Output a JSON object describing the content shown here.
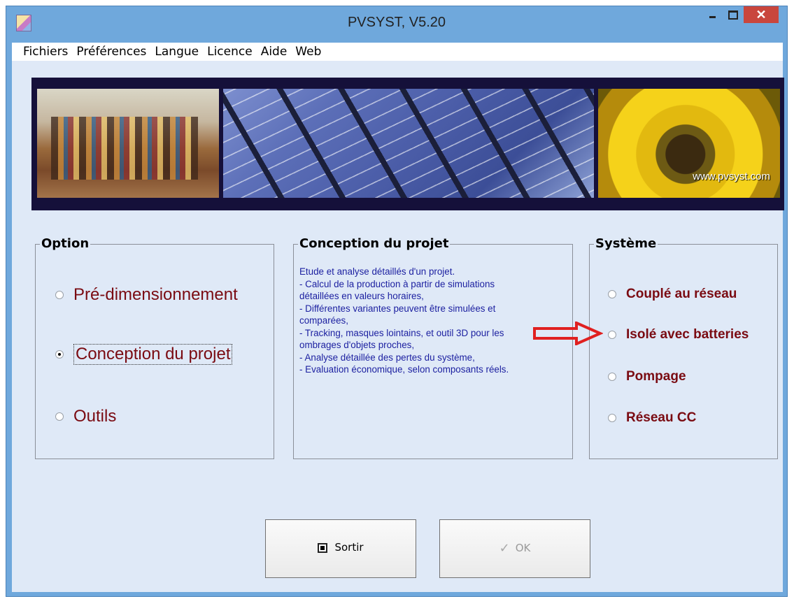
{
  "window": {
    "title": "PVSYST, V5.20",
    "close_glyph": "✕"
  },
  "menu": [
    "Fichiers",
    "Préférences",
    "Langue",
    "Licence",
    "Aide",
    "Web"
  ],
  "banner": {
    "url": "www.pvsyst.com"
  },
  "option_group": {
    "title": "Option",
    "items": [
      {
        "label": "Pré-dimensionnement",
        "checked": false
      },
      {
        "label": "Conception du projet",
        "checked": true
      },
      {
        "label": "Outils",
        "checked": false
      }
    ]
  },
  "concept_group": {
    "title": "Conception du projet",
    "lines": [
      "Etude et analyse détaillés d'un projet.",
      "- Calcul de la production à partir de simulations",
      "détaillées en valeurs horaires,",
      "- Différentes variantes peuvent être simulées et",
      "comparées,",
      "- Tracking, masques lointains, et outil 3D pour les",
      "ombrages d'objets proches,",
      "- Analyse détaillée des pertes du système,",
      "- Evaluation économique, selon composants réels."
    ]
  },
  "system_group": {
    "title": "Système",
    "items": [
      {
        "label": "Couplé au réseau",
        "checked": false
      },
      {
        "label": "Isolé avec batteries",
        "checked": false
      },
      {
        "label": "Pompage",
        "checked": false
      },
      {
        "label": "Réseau CC",
        "checked": false
      }
    ]
  },
  "buttons": {
    "exit_label": "Sortir",
    "ok_label": "OK"
  },
  "colors": {
    "label_red": "#7a0b12",
    "description_blue": "#1b1fa0",
    "arrow_red": "#e02020"
  }
}
